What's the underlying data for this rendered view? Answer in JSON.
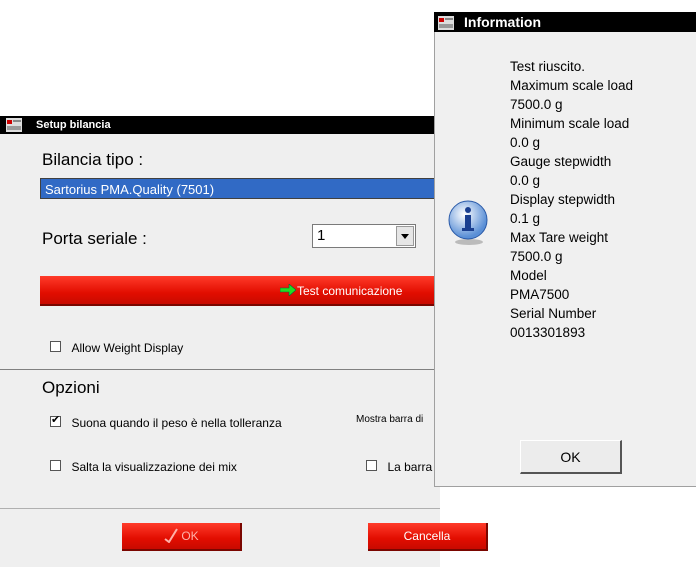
{
  "setup": {
    "title": "Setup bilancia",
    "scale_type_heading": "Bilancia tipo :",
    "scale_type_value": "Sartorius PMA.Quality (7501)",
    "serial_port_label": "Porta seriale :",
    "serial_port_value": "1",
    "test_button_label": "Test comunicazione",
    "allow_weight_display": "Allow Weight Display",
    "options_heading": "Opzioni",
    "sound_option": "Suona quando il peso è nella tolleranza",
    "show_bar_option": "Mostra barra di",
    "skip_mix_option": "Salta la visualizzazione dei mix",
    "bar_option": "La barra",
    "ok_label": "OK",
    "cancel_label": "Cancella",
    "checkbox_states": {
      "allow_weight_display": false,
      "sound": true,
      "skip_mix": false,
      "bar": false
    }
  },
  "info": {
    "title": "Information",
    "lines": [
      "Test riuscito.",
      "Maximum scale load",
      "7500.0 g",
      "Minimum scale load",
      "0.0 g",
      "Gauge stepwidth",
      "0.0 g",
      "Display stepwidth",
      "0.1 g",
      "Max Tare weight",
      "7500.0 g",
      "Model",
      "PMA7500",
      "Serial Number",
      "0013301893"
    ],
    "ok_label": "OK"
  },
  "icons": {
    "app": "app-logo-icon",
    "info": "info-icon",
    "arrow": "green-arrow-icon",
    "check": "checkmark-icon",
    "ok": "pen-check-icon",
    "dropdown": "chevron-down-icon"
  }
}
